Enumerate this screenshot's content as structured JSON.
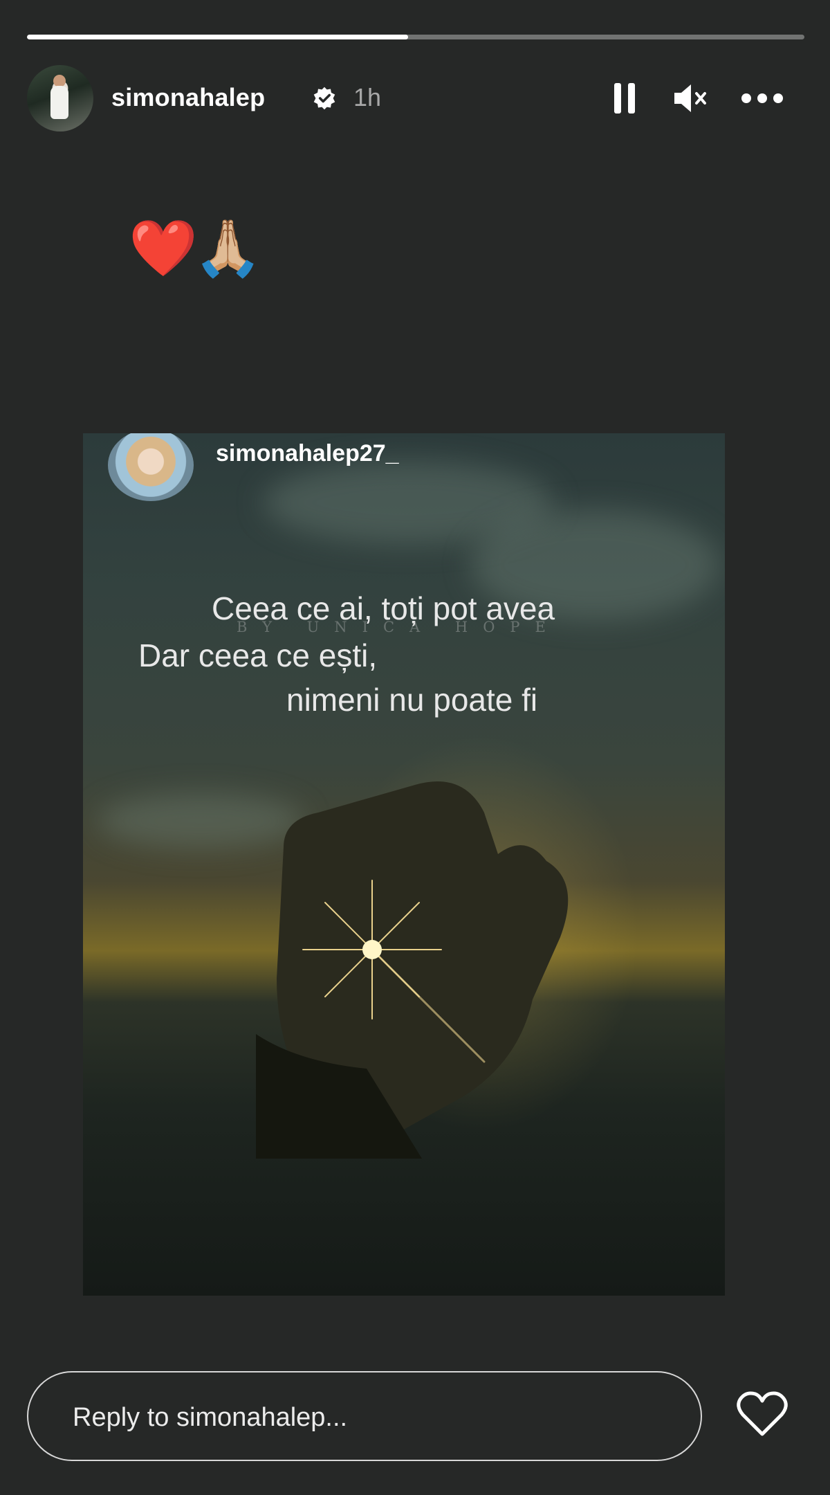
{
  "story": {
    "progress_fraction": 0.49,
    "username": "simonahalep",
    "time": "1h",
    "emojis": "❤️🙏🏼"
  },
  "shared_post": {
    "username": "simonahalep27_",
    "quote_line1": "Ceea ce ai, toți pot avea",
    "watermark": "BY UNICA HOPE",
    "quote_line2": "Dar ceea ce ești,",
    "quote_line3": "nimeni nu poate fi"
  },
  "reply": {
    "placeholder": "Reply to simonahalep..."
  },
  "icons": {
    "pause": "pause-icon",
    "mute": "muted-speaker-icon",
    "more": "more-options-icon",
    "verified": "verified-badge-icon",
    "like": "heart-icon"
  }
}
